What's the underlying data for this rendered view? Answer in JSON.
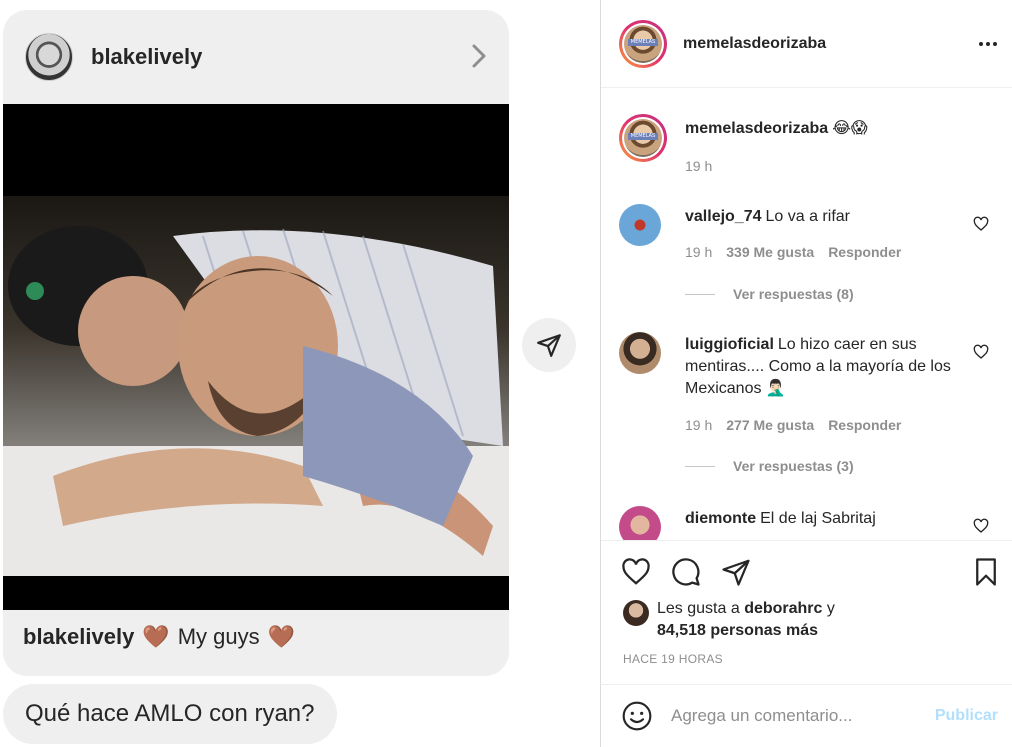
{
  "shared_post": {
    "username": "blakelively",
    "caption_user": "blakelively",
    "caption_text": "My guys",
    "caption_emoji": "🤎"
  },
  "message": {
    "text": "Qué hace AMLO con ryan?"
  },
  "post": {
    "author": "memelasdeorizaba",
    "caption_emoji": "😂😱",
    "caption_time": "19 h"
  },
  "comments": [
    {
      "user": "vallejo_74",
      "text": "Lo va a rifar",
      "time": "19 h",
      "likes": "339 Me gusta",
      "reply": "Responder",
      "view_replies": "Ver respuestas (8)"
    },
    {
      "user": "luiggioficial",
      "text": "Lo hizo caer en sus mentiras.... Como a la mayoría de los Mexicanos 🤦🏻‍♂️",
      "time": "19 h",
      "likes": "277 Me gusta",
      "reply": "Responder",
      "view_replies": "Ver respuestas (3)"
    },
    {
      "user": "diemonte",
      "text": "El de laj Sabritaj"
    }
  ],
  "likes": {
    "prefix": "Les gusta a",
    "user": "deborahrc",
    "suffix": "y",
    "others": "84,518 personas más"
  },
  "posted_ago": "HACE 19 HORAS",
  "comment_box": {
    "placeholder": "Agrega un comentario...",
    "post_label": "Publicar"
  },
  "colors": {
    "accent_blue_disabled": "#b2dffc",
    "story_ring": "#e1306c",
    "muted_text": "#8e8e8e"
  },
  "icons": [
    "chevron-right-icon",
    "send-icon",
    "more-icon",
    "heart-icon",
    "comment-icon",
    "share-icon",
    "bookmark-icon",
    "emoji-icon"
  ]
}
